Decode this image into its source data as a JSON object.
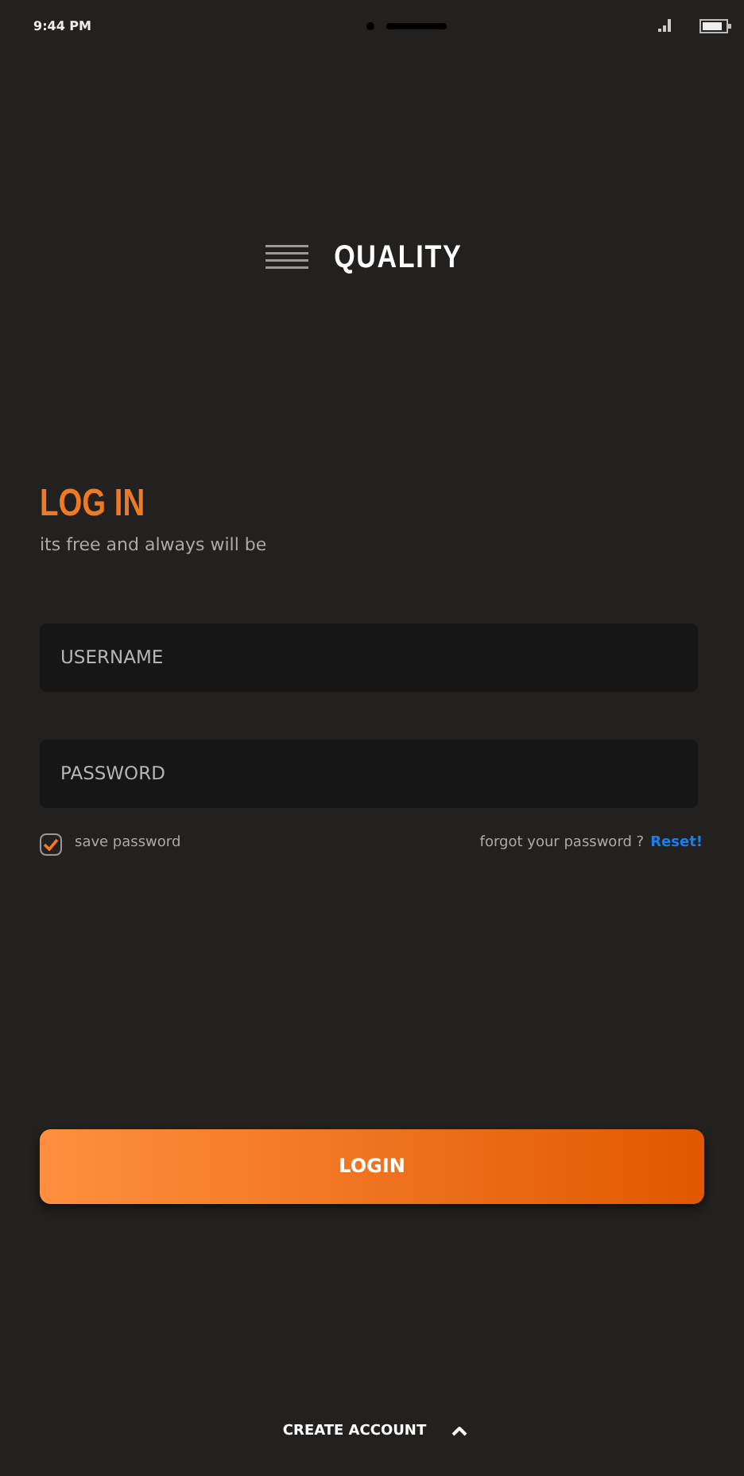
{
  "status_bar": {
    "time": "9:44 PM"
  },
  "logo": {
    "text": "QUALITY"
  },
  "heading": "LOG IN",
  "subtitle": "its free and always will be",
  "fields": [
    {
      "placeholder": "USERNAME"
    },
    {
      "placeholder": "PASSWORD"
    }
  ],
  "save_password": {
    "label": "save password",
    "checked": true
  },
  "forgot": {
    "text": "forgot your password ?",
    "link": "Reset!"
  },
  "login_button": "LOGIN",
  "create_account": {
    "label": "CREATE ACCOUNT",
    "expanded": false
  }
}
